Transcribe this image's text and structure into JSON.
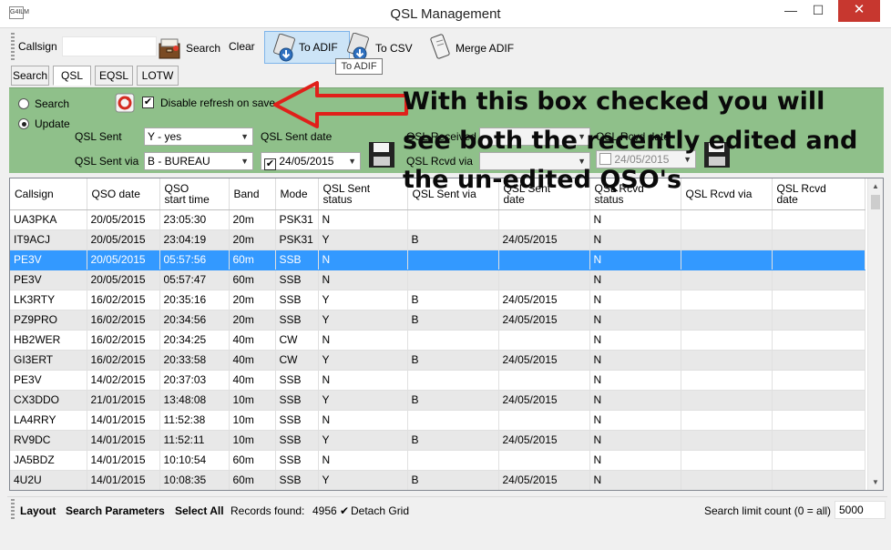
{
  "window": {
    "title": "QSL Management",
    "icon_text": "G4ILM",
    "min_glyph": "—",
    "max_glyph": "☐",
    "close_glyph": "✕"
  },
  "toolbar": {
    "callsign_label": "Callsign",
    "callsign_value": "",
    "search_label": "Search",
    "clear_label": "Clear",
    "to_adif_label": "To ADIF",
    "to_csv_label": "To CSV",
    "merge_adif_label": "Merge ADIF",
    "tooltip": "To ADIF"
  },
  "tabs": [
    {
      "label": "Search"
    },
    {
      "label": "QSL"
    },
    {
      "label": "EQSL"
    },
    {
      "label": "LOTW"
    }
  ],
  "panel": {
    "mode_search_label": "Search",
    "mode_update_label": "Update",
    "mode_selected": "Update",
    "disable_refresh_label": "Disable refresh on save",
    "disable_refresh_checked": true,
    "qsl_sent_label": "QSL Sent",
    "qsl_sent_value": "Y - yes",
    "qsl_sent_via_label": "QSL Sent via",
    "qsl_sent_via_value": "B - BUREAU",
    "qsl_sent_date_label": "QSL Sent date",
    "qsl_sent_date_value": "24/05/2015",
    "qsl_sent_date_checked": true,
    "qsl_received_label": "QSL Received",
    "qsl_received_value": "",
    "qsl_rcvd_via_label": "QSL Rcvd via",
    "qsl_rcvd_via_value": "",
    "qsl_rcvd_date_label": "QSL Rcvd date",
    "qsl_rcvd_date_value": "24/05/2015",
    "qsl_rcvd_date_checked": false
  },
  "annotation": "With this box checked you will see both the recently edited and the un-edited QSO's",
  "grid": {
    "columns": [
      {
        "line1": "Callsign",
        "line2": ""
      },
      {
        "line1": "QSO date",
        "line2": ""
      },
      {
        "line1": "QSO",
        "line2": "start time"
      },
      {
        "line1": "Band",
        "line2": ""
      },
      {
        "line1": "Mode",
        "line2": ""
      },
      {
        "line1": "QSL Sent",
        "line2": "status"
      },
      {
        "line1": "QSL Sent via",
        "line2": ""
      },
      {
        "line1": "QSL Sent",
        "line2": "date"
      },
      {
        "line1": "QSL Rcvd",
        "line2": "status"
      },
      {
        "line1": "QSL Rcvd via",
        "line2": ""
      },
      {
        "line1": "QSL Rcvd",
        "line2": "date"
      }
    ],
    "selected_row": 2,
    "rows": [
      [
        "UA3PKA",
        "20/05/2015",
        "23:05:30",
        "20m",
        "PSK31",
        "N",
        "",
        "",
        "N",
        "",
        ""
      ],
      [
        "IT9ACJ",
        "20/05/2015",
        "23:04:19",
        "20m",
        "PSK31",
        "Y",
        "B",
        "24/05/2015",
        "N",
        "",
        ""
      ],
      [
        "PE3V",
        "20/05/2015",
        "05:57:56",
        "60m",
        "SSB",
        "N",
        "",
        "",
        "N",
        "",
        ""
      ],
      [
        "PE3V",
        "20/05/2015",
        "05:57:47",
        "60m",
        "SSB",
        "N",
        "",
        "",
        "N",
        "",
        ""
      ],
      [
        "LK3RTY",
        "16/02/2015",
        "20:35:16",
        "20m",
        "SSB",
        "Y",
        "B",
        "24/05/2015",
        "N",
        "",
        ""
      ],
      [
        "PZ9PRO",
        "16/02/2015",
        "20:34:56",
        "20m",
        "SSB",
        "Y",
        "B",
        "24/05/2015",
        "N",
        "",
        ""
      ],
      [
        "HB2WER",
        "16/02/2015",
        "20:34:25",
        "40m",
        "CW",
        "N",
        "",
        "",
        "N",
        "",
        ""
      ],
      [
        "GI3ERT",
        "16/02/2015",
        "20:33:58",
        "40m",
        "CW",
        "Y",
        "B",
        "24/05/2015",
        "N",
        "",
        ""
      ],
      [
        "PE3V",
        "14/02/2015",
        "20:37:03",
        "40m",
        "SSB",
        "N",
        "",
        "",
        "N",
        "",
        ""
      ],
      [
        "CX3DDO",
        "21/01/2015",
        "13:48:08",
        "10m",
        "SSB",
        "Y",
        "B",
        "24/05/2015",
        "N",
        "",
        ""
      ],
      [
        "LA4RRY",
        "14/01/2015",
        "11:52:38",
        "10m",
        "SSB",
        "N",
        "",
        "",
        "N",
        "",
        ""
      ],
      [
        "RV9DC",
        "14/01/2015",
        "11:52:11",
        "10m",
        "SSB",
        "Y",
        "B",
        "24/05/2015",
        "N",
        "",
        ""
      ],
      [
        "JA5BDZ",
        "14/01/2015",
        "10:10:54",
        "60m",
        "SSB",
        "N",
        "",
        "",
        "N",
        "",
        ""
      ],
      [
        "4U2U",
        "14/01/2015",
        "10:08:35",
        "60m",
        "SSB",
        "Y",
        "B",
        "24/05/2015",
        "N",
        "",
        ""
      ]
    ]
  },
  "statusbar": {
    "layout_label": "Layout",
    "search_params_label": "Search Parameters",
    "select_all_label": "Select All",
    "records_found_label": "Records found:",
    "records_found_value": "4956",
    "detach_grid_label": "Detach Grid",
    "search_limit_label": "Search limit count (0 = all)",
    "search_limit_value": "5000"
  },
  "colors": {
    "panel_green": "#8fc08a",
    "selected_row": "#3399ff",
    "arrow_red": "#e0201a"
  }
}
